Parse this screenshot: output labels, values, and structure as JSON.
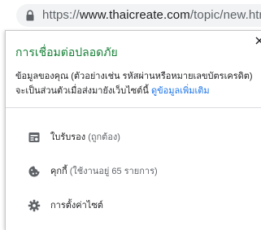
{
  "omnibox": {
    "scheme": "https://",
    "domain": "www.thaicreate.com",
    "path": "/topic/new.html"
  },
  "popup": {
    "title": "การเชื่อมต่อปลอดภัย",
    "description": "ข้อมูลของคุณ (ตัวอย่างเช่น รหัสผ่านหรือหมายเลขบัตรเครดิต) จะเป็นส่วนตัวเมื่อส่งมายังเว็บไซต์นี้",
    "learn_more": "ดูข้อมูลเพิ่มเติม",
    "certificate": {
      "label": "ใบรับรอง",
      "detail": "(ถูกต้อง)"
    },
    "cookies": {
      "label": "คุกกี้",
      "detail": "(ใช้งานอยู่ 65 รายการ)"
    },
    "site_settings": {
      "label": "การตั้งค่าไซต์"
    }
  },
  "colors": {
    "secure_green": "#188038",
    "link_blue": "#1a73e8",
    "icon_gray": "#5f6368"
  },
  "icons": [
    "lock-icon",
    "close-icon",
    "certificate-icon",
    "cookie-icon",
    "gear-icon"
  ]
}
